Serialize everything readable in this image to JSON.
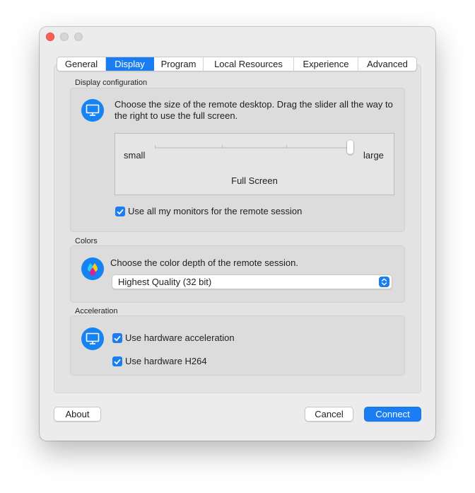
{
  "window": {
    "traffic_lights": [
      "close",
      "minimize",
      "zoom"
    ]
  },
  "tabs": [
    {
      "label": "General",
      "active": false
    },
    {
      "label": "Display",
      "active": true
    },
    {
      "label": "Program",
      "active": false
    },
    {
      "label": "Local Resources",
      "active": false
    },
    {
      "label": "Experience",
      "active": false
    },
    {
      "label": "Advanced",
      "active": false
    }
  ],
  "display_configuration": {
    "section_label": "Display configuration",
    "icon": "monitor-icon",
    "description": "Choose the size of the remote desktop. Drag the slider all the way to the right to use the full screen.",
    "slider": {
      "min_label": "small",
      "max_label": "large",
      "value_label": "Full Screen",
      "position": 1.0,
      "ticks": 4
    },
    "all_monitors": {
      "label": "Use all my monitors for the remote session",
      "checked": true
    }
  },
  "colors": {
    "section_label": "Colors",
    "icon": "color-drops-icon",
    "description": "Choose the color depth of the remote session.",
    "select_value": "Highest Quality (32 bit)"
  },
  "acceleration": {
    "section_label": "Acceleration",
    "icon": "monitor-icon",
    "hardware_acceleration": {
      "label": "Use hardware acceleration",
      "checked": true
    },
    "hardware_h264": {
      "label": "Use hardware H264",
      "checked": true
    }
  },
  "footer": {
    "about_label": "About",
    "cancel_label": "Cancel",
    "connect_label": "Connect"
  },
  "colors_palette": {
    "accent": "#1a7ef2",
    "close_light": "#ff5f57",
    "inactive_light": "#d6d6d6"
  }
}
